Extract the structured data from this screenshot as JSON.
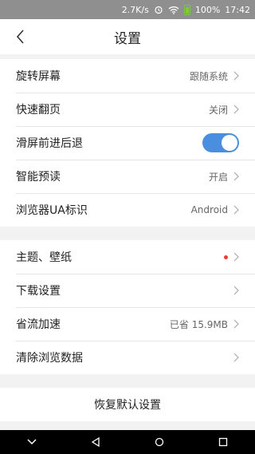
{
  "statusbar": {
    "speed": "2.7K/s",
    "battery": "100%",
    "time": "17:42"
  },
  "header": {
    "title": "设置"
  },
  "group1": [
    {
      "label": "旋转屏幕",
      "value": "跟随系统"
    },
    {
      "label": "快速翻页",
      "value": "关闭"
    },
    {
      "label": "滑屏前进后退",
      "toggle": true
    },
    {
      "label": "智能预读",
      "value": "开启"
    },
    {
      "label": "浏览器UA标识",
      "value": "Android"
    }
  ],
  "group2": [
    {
      "label": "主题、壁纸",
      "badge": true
    },
    {
      "label": "下载设置"
    },
    {
      "label": "省流加速",
      "value": "已省 15.9MB"
    },
    {
      "label": "清除浏览数据"
    }
  ],
  "reset_label": "恢复默认设置",
  "colors": {
    "toggle_on": "#4a8ee0",
    "badge": "#e5412f"
  }
}
